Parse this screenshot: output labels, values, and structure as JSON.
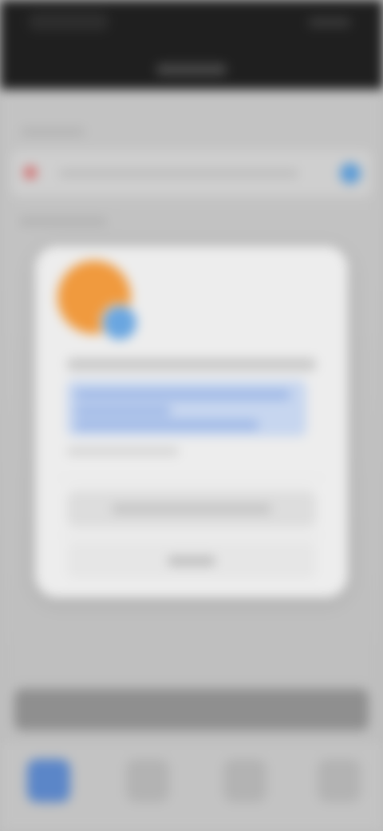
{
  "window": {
    "title": ""
  },
  "status_bar": {
    "time": "",
    "indicators": ""
  },
  "header": {
    "title": "",
    "section_label": ""
  },
  "search": {
    "placeholder": "",
    "left_icon": "location-pin-icon",
    "right_icon": "profile-icon"
  },
  "list": {
    "section_label": ""
  },
  "modal": {
    "line1": "",
    "highlight_text": "",
    "small_text": "",
    "primary_button_label": "",
    "secondary_button_label": "",
    "avatar_colors": [
      "#f09a3e",
      "#6aa6e0"
    ]
  },
  "bottom_button": {
    "label": ""
  },
  "tabs": [
    {
      "label": "",
      "icon": "home-icon",
      "active": true
    },
    {
      "label": "",
      "icon": "search-icon",
      "active": false
    },
    {
      "label": "",
      "icon": "list-icon",
      "active": false
    },
    {
      "label": "",
      "icon": "profile-icon",
      "active": false
    }
  ],
  "colors": {
    "accent": "#5b86c8",
    "topbar": "#1f1f1f",
    "background": "#c0c0c0"
  }
}
